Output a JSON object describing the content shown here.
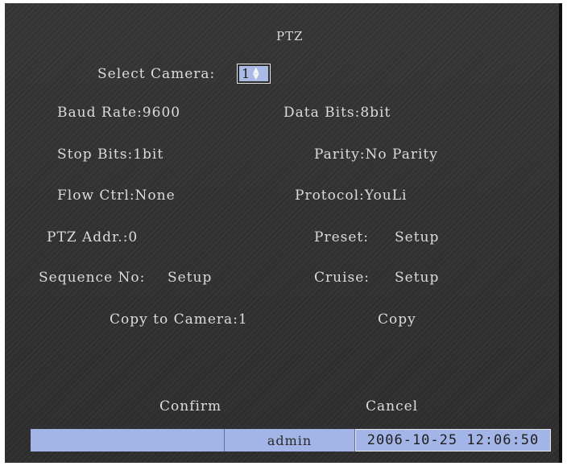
{
  "window": {
    "title": "PTZ"
  },
  "camera": {
    "label": "Select Camera:",
    "value": "1"
  },
  "fields": {
    "baud_rate": "Baud Rate:9600",
    "data_bits": "Data Bits:8bit",
    "stop_bits": "Stop Bits:1bit",
    "parity": "Parity:No Parity",
    "flow_ctrl": "Flow Ctrl:None",
    "protocol": "Protocol:YouLi",
    "ptz_addr": "PTZ Addr.:0",
    "preset_label": "Preset:",
    "preset_action": "Setup",
    "sequence_label": "Sequence No:",
    "sequence_action": "Setup",
    "cruise_label": "Cruise:",
    "cruise_action": "Setup"
  },
  "copy": {
    "label": "Copy to Camera:1",
    "button": "Copy"
  },
  "actions": {
    "confirm": "Confirm",
    "cancel": "Cancel"
  },
  "status": {
    "user": "admin",
    "datetime": "2006-10-25 12:06:50"
  },
  "icons": {
    "spinner": "up-down-arrows-icon"
  }
}
